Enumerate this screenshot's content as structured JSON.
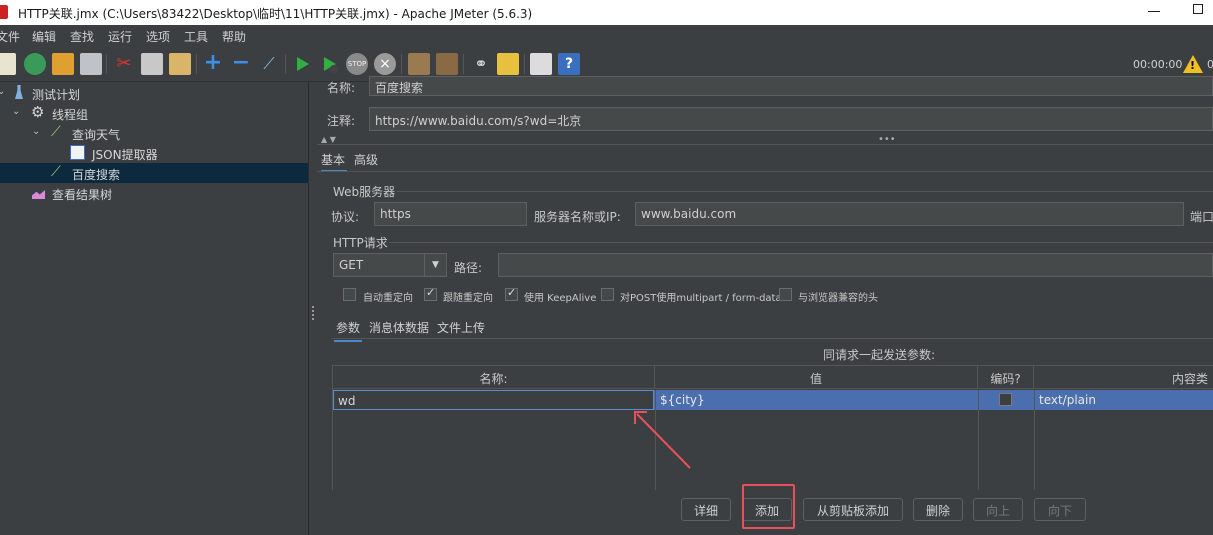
{
  "window": {
    "title": "HTTP关联.jmx (C:\\Users\\83422\\Desktop\\临时\\11\\HTTP关联.jmx) - Apache JMeter (5.6.3)"
  },
  "menu": [
    "文件",
    "编辑",
    "查找",
    "运行",
    "选项",
    "工具",
    "帮助"
  ],
  "toolbar": {
    "icons": [
      "new-icon",
      "templates-icon",
      "open-icon",
      "save-icon",
      "cut-icon",
      "copy-icon",
      "paste-icon",
      "expand-icon",
      "collapse-icon",
      "toggle-icon",
      "start-icon",
      "start-no-pause-icon",
      "stop-icon",
      "shutdown-icon",
      "clear-icon",
      "clear-all-icon",
      "search-icon",
      "reset-search-icon",
      "function-helper-icon",
      "help-icon"
    ],
    "timer": "00:00:00",
    "warning_count": "0"
  },
  "tree": [
    {
      "label": "测试计划",
      "icon": "test-plan-icon",
      "expanded": true
    },
    {
      "label": "线程组",
      "icon": "thread-group-icon",
      "expanded": true
    },
    {
      "label": "查询天气",
      "icon": "sampler-icon",
      "expanded": true
    },
    {
      "label": "JSON提取器",
      "icon": "extractor-icon"
    },
    {
      "label": "百度搜索",
      "icon": "sampler-icon",
      "selected": true
    },
    {
      "label": "查看结果树",
      "icon": "listener-icon"
    }
  ],
  "sampler": {
    "name_label": "名称:",
    "name_value": "百度搜索",
    "comment_label": "注释:",
    "comment_value": "https://www.baidu.com/s?wd=北京",
    "tabs": [
      "基本",
      "高级"
    ],
    "web_server_title": "Web服务器",
    "protocol_label": "协议:",
    "protocol_value": "https",
    "server_label": "服务器名称或IP:",
    "server_value": "www.baidu.com",
    "port_label": "端口",
    "http_request_title": "HTTP请求",
    "method": "GET",
    "path_label": "路径:",
    "path_value": "",
    "options": [
      {
        "label": "自动重定向",
        "checked": false
      },
      {
        "label": "跟随重定向",
        "checked": true
      },
      {
        "label": "使用 KeepAlive",
        "checked": true
      },
      {
        "label": "对POST使用multipart / form-data",
        "checked": false
      },
      {
        "label": "与浏览器兼容的头",
        "checked": false
      }
    ],
    "sub_tabs": [
      "参数",
      "消息体数据",
      "文件上传"
    ],
    "params_caption": "同请求一起发送参数:",
    "params_columns": [
      "名称:",
      "值",
      "编码?",
      "内容类型"
    ],
    "params_rows": [
      {
        "name": "wd",
        "value": "${city}",
        "encode": false,
        "content_type": "text/plain"
      }
    ],
    "buttons": {
      "detail": "详细",
      "add": "添加",
      "add_from_clipboard": "从剪贴板添加",
      "delete": "删除",
      "up": "向上",
      "down": "向下"
    }
  },
  "colors": {
    "background": "#3c3f41",
    "selection": "#4b6eaf",
    "tree_selection": "#0d293e",
    "highlight": "#e8505b"
  }
}
